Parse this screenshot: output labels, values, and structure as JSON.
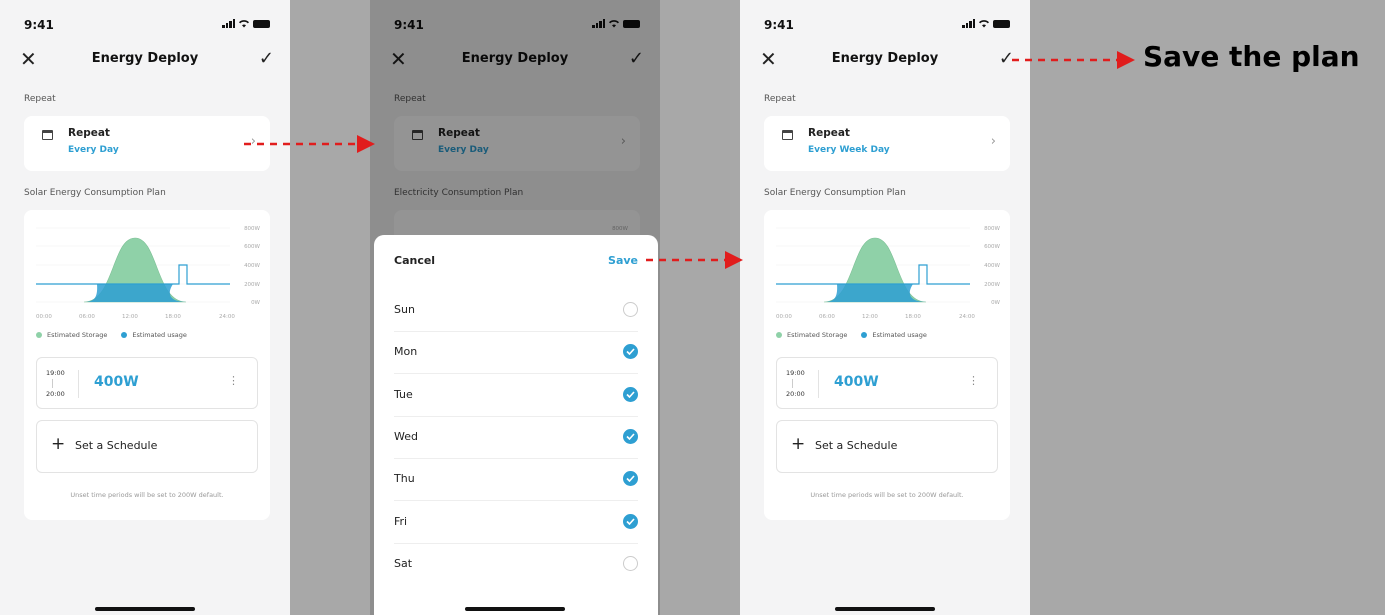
{
  "status_time": "9:41",
  "colors": {
    "accent": "#2e9fd2",
    "storage": "#8fd1a8",
    "usage": "#2e9fd2",
    "arrow": "#e11d1d"
  },
  "screens": [
    {
      "nav": {
        "close": "✕",
        "title": "Energy Deploy",
        "check": "✓"
      },
      "repeat_section": "Repeat",
      "repeat_card": {
        "title": "Repeat",
        "value": "Every Day",
        "chevron": "›"
      },
      "plan_section": "Solar Energy Consumption Plan",
      "chart": {
        "y_ticks": [
          "800W",
          "600W",
          "400W",
          "200W",
          "0W"
        ],
        "x_ticks": [
          "00:00",
          "06:00",
          "12:00",
          "18:00",
          "24:00"
        ]
      },
      "legend": {
        "storage": "Estimated Storage",
        "usage": "Estimated usage"
      },
      "schedule": {
        "start": "19:00",
        "end": "20:00",
        "value": "400W",
        "more": "⋮"
      },
      "add_schedule": {
        "plus": "+",
        "label": "Set a Schedule"
      },
      "footnote": "Unset time periods will be set to 200W default."
    },
    {
      "nav": {
        "close": "✕",
        "title": "Energy Deploy",
        "check": "✓"
      },
      "repeat_section": "Repeat",
      "repeat_card": {
        "title": "Repeat",
        "value": "Every Day",
        "chevron": "›"
      },
      "plan_section": "Electricity Consumption Plan",
      "chart_y_top": "800W",
      "sheet": {
        "cancel": "Cancel",
        "save": "Save",
        "days": [
          {
            "name": "Sun",
            "checked": false
          },
          {
            "name": "Mon",
            "checked": true
          },
          {
            "name": "Tue",
            "checked": true
          },
          {
            "name": "Wed",
            "checked": true
          },
          {
            "name": "Thu",
            "checked": true
          },
          {
            "name": "Fri",
            "checked": true
          },
          {
            "name": "Sat",
            "checked": false
          }
        ]
      }
    },
    {
      "nav": {
        "close": "✕",
        "title": "Energy Deploy",
        "check": "✓"
      },
      "repeat_section": "Repeat",
      "repeat_card": {
        "title": "Repeat",
        "value": "Every Week Day",
        "chevron": "›"
      },
      "plan_section": "Solar Energy Consumption Plan",
      "chart": {
        "y_ticks": [
          "800W",
          "600W",
          "400W",
          "200W",
          "0W"
        ],
        "x_ticks": [
          "00:00",
          "06:00",
          "12:00",
          "18:00",
          "24:00"
        ]
      },
      "legend": {
        "storage": "Estimated Storage",
        "usage": "Estimated usage"
      },
      "schedule": {
        "start": "19:00",
        "end": "20:00",
        "value": "400W",
        "more": "⋮"
      },
      "add_schedule": {
        "plus": "+",
        "label": "Set a Schedule"
      },
      "footnote": "Unset time periods will be set to 200W default."
    }
  ],
  "callout": "Save the plan"
}
